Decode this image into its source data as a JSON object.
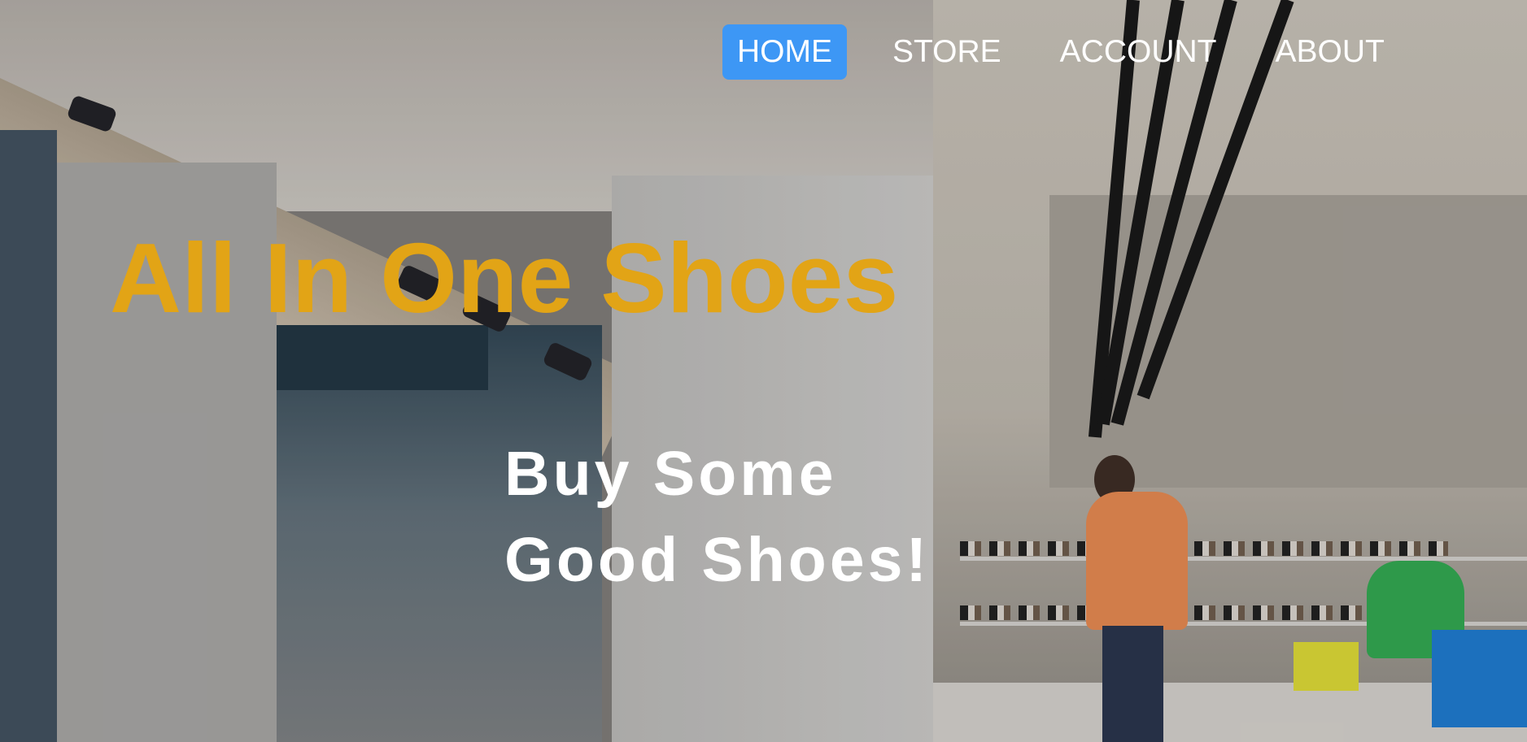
{
  "nav": {
    "items": [
      {
        "label": "HOME",
        "active": true
      },
      {
        "label": "STORE",
        "active": false
      },
      {
        "label": "ACCOUNT",
        "active": false
      },
      {
        "label": "ABOUT",
        "active": false
      }
    ]
  },
  "hero": {
    "title": "All In One Shoes",
    "subtitle_line1": "Buy Some",
    "subtitle_line2": "Good Shoes!"
  },
  "colors": {
    "nav_active_bg": "#3d97f5",
    "title": "#e2a416",
    "subtitle": "#ffffff"
  }
}
